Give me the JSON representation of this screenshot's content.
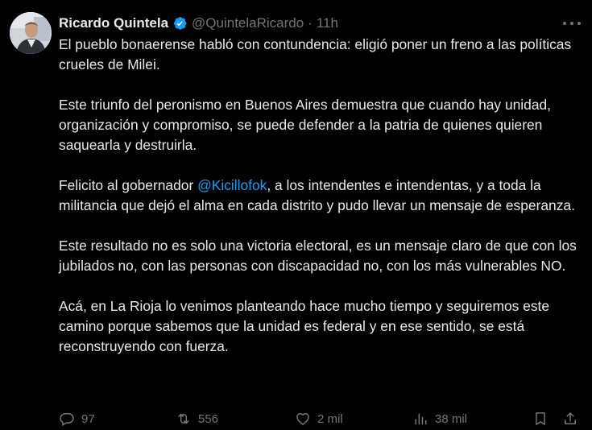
{
  "tweet": {
    "author": {
      "name": "Ricardo Quintela",
      "handle": "@QuintelaRicardo",
      "verified": true,
      "avatar": "profile-photo"
    },
    "separator": "·",
    "time": "11h",
    "paragraphs": [
      [
        {
          "text": "El pueblo bonaerense habló con contundencia: eligió poner un freno a las políticas crueles de Milei."
        }
      ],
      [
        {
          "text": "Este triunfo del peronismo en Buenos Aires demuestra que cuando hay unidad, organización y compromiso, se puede defender a la patria de quienes quieren saquearla y destruirla."
        }
      ],
      [
        {
          "text": "Felicito al gobernador "
        },
        {
          "text": "@Kicillofok",
          "mention": true
        },
        {
          "text": ", a los intendentes e intendentas, y a toda la militancia que dejó el alma en cada distrito y pudo llevar un mensaje de esperanza."
        }
      ],
      [
        {
          "text": "Este resultado no es solo una victoria electoral, es un mensaje claro de que con los jubilados no, con las personas con discapacidad no, con los más vulnerables NO."
        }
      ],
      [
        {
          "text": "Acá, en La Rioja lo venimos planteando hace mucho tiempo y seguiremos este camino porque sabemos que la unidad es federal y en ese sentido, se está reconstruyendo con fuerza."
        }
      ]
    ],
    "actions": {
      "replies": "97",
      "reposts": "556",
      "likes": "2 mil",
      "views": "38 mil"
    },
    "icons": {
      "verified": "verified-badge-icon",
      "more": "more-icon",
      "reply": "reply-icon",
      "repost": "repost-icon",
      "like": "like-icon",
      "views": "views-icon",
      "bookmark": "bookmark-icon",
      "share": "share-icon"
    }
  },
  "colors": {
    "background": "#000000",
    "text": "#e7e9ea",
    "secondary": "#71767b",
    "link": "#1d9bf0"
  }
}
